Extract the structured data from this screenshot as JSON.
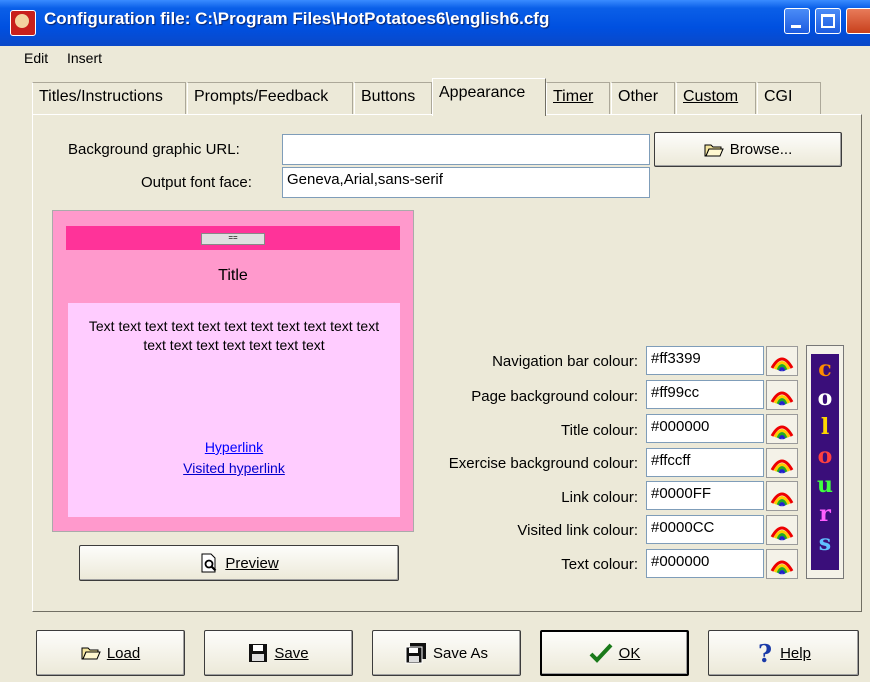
{
  "window": {
    "title": "Configuration file: C:\\Program Files\\HotPotatoes6\\english6.cfg"
  },
  "menu": [
    "Edit",
    "Insert"
  ],
  "tabs": [
    {
      "label": "Titles/Instructions"
    },
    {
      "label": "Prompts/Feedback"
    },
    {
      "label": "Buttons"
    },
    {
      "label": "Appearance",
      "active": true
    },
    {
      "label": "Timer"
    },
    {
      "label": "Other"
    },
    {
      "label": "Custom"
    },
    {
      "label": "CGI"
    }
  ],
  "appearance": {
    "bg_graphic_label": "Background graphic URL:",
    "bg_graphic_value": "",
    "browse_label": "Browse...",
    "font_face_label": "Output font face:",
    "font_face_value": "Geneva,Arial,sans-serif"
  },
  "preview": {
    "nav_label": "==",
    "title": "Title",
    "sample_text": "Text text text text text text text text text text text text text text text text text text",
    "hyperlink": "Hyperlink",
    "visited_hyperlink": "Visited hyperlink",
    "preview_button": "Preview"
  },
  "colours": [
    {
      "label": "Navigation bar colour:",
      "value": "#ff3399"
    },
    {
      "label": "Page background colour:",
      "value": "#ff99cc"
    },
    {
      "label": "Title colour:",
      "value": "#000000"
    },
    {
      "label": "Exercise background colour:",
      "value": "#ffccff"
    },
    {
      "label": "Link colour:",
      "value": "#0000FF"
    },
    {
      "label": "Visited link colour:",
      "value": "#0000CC"
    },
    {
      "label": "Text colour:",
      "value": "#000000"
    }
  ],
  "colours_button_letters": [
    "c",
    "o",
    "l",
    "o",
    "u",
    "r",
    "s"
  ],
  "footer": {
    "load": "Load",
    "save": "Save",
    "save_as": "Save As",
    "ok": "OK",
    "help": "Help"
  },
  "icons": {
    "app": "hotpotatoes-icon",
    "browse": "folder-open-icon",
    "preview": "magnifier-document-icon",
    "load": "folder-open-icon",
    "save": "floppy-disk-icon",
    "save_as": "floppy-disk-stack-icon",
    "ok": "checkmark-icon",
    "help": "question-mark-icon",
    "colour_picker": "rainbow-icon"
  }
}
